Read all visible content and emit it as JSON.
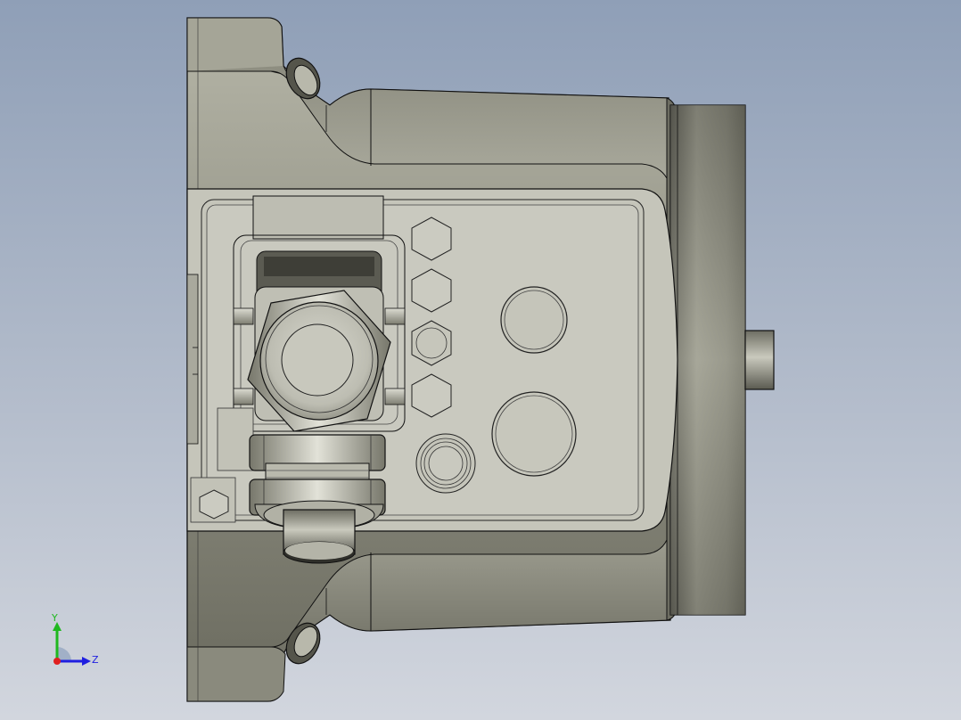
{
  "viewport": {
    "background_top": "#8f9fb7",
    "background_bottom": "#d2d6de"
  },
  "part": {
    "body_color": "#a3a394",
    "panel_color": "#c9c9bf",
    "edge_color": "#111111",
    "dark_shade": "#5e5e52",
    "light_shade": "#d6d6cb"
  },
  "triad": {
    "y_label": "Y",
    "z_label": "Z",
    "y_color": "#1fb81f",
    "z_color": "#1f1fe0",
    "x_color": "#e01f1f"
  }
}
